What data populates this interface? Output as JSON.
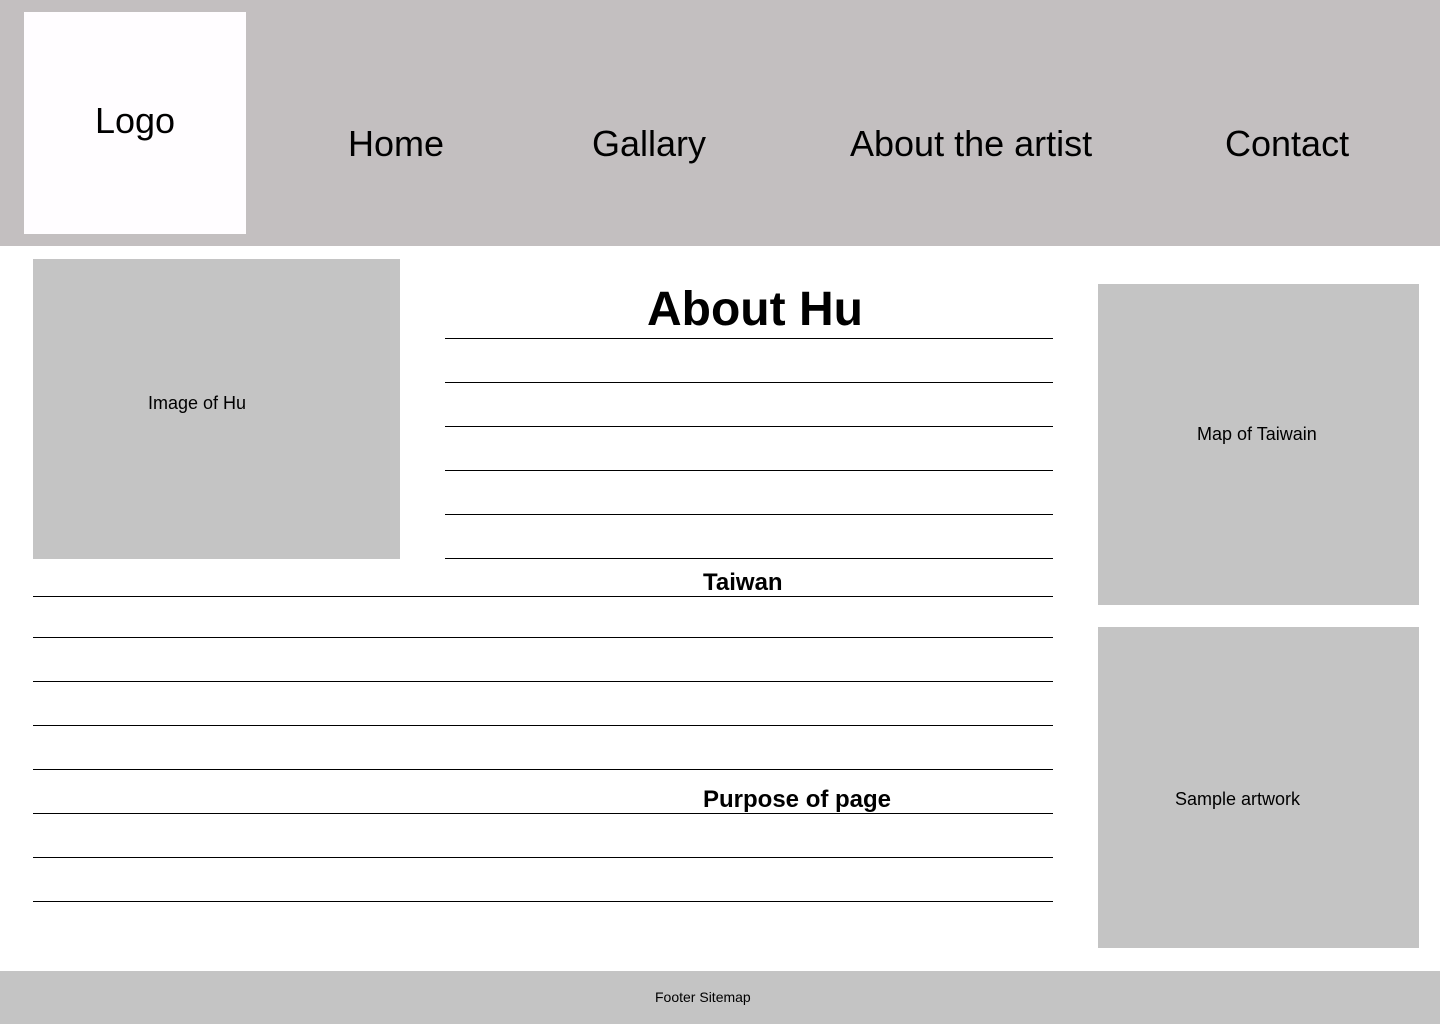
{
  "header": {
    "logo_label": "Logo",
    "nav": {
      "home": "Home",
      "gallery": "Gallary",
      "about": "About the artist",
      "contact": "Contact"
    }
  },
  "main": {
    "image_label": "Image of Hu",
    "title": "About Hu",
    "section_taiwan": "Taiwan",
    "section_purpose": "Purpose of page"
  },
  "sidebar": {
    "map_label": "Map of Taiwain",
    "artwork_label": "Sample artwork"
  },
  "footer": {
    "label": "Footer Sitemap"
  },
  "colors": {
    "header_bg": "#c3bfc0",
    "placeholder_bg": "#c4c4c4",
    "logo_bg": "#fffdff",
    "rule": "#000000"
  }
}
